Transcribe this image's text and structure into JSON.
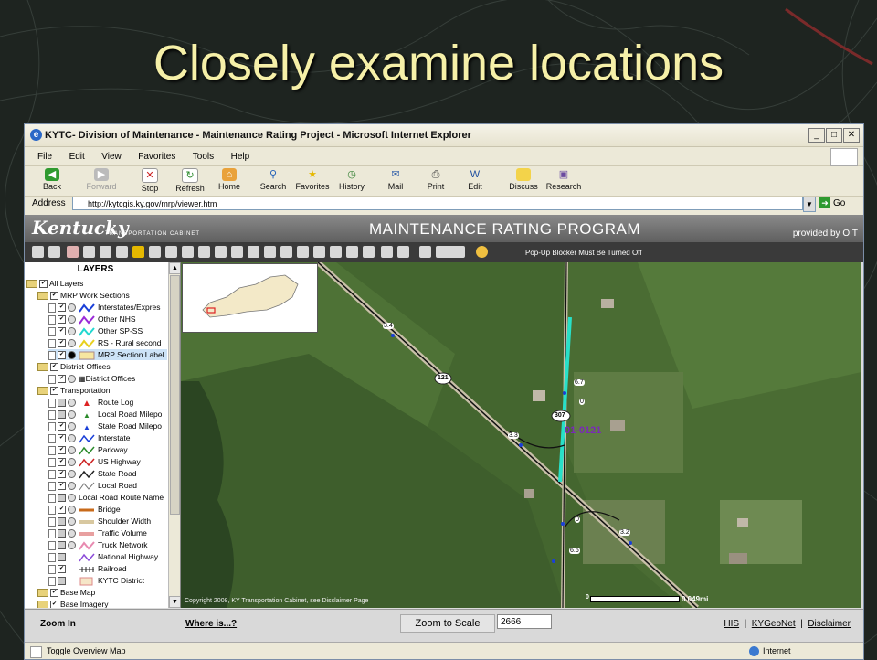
{
  "slide": {
    "title": "Closely examine locations"
  },
  "browser": {
    "window_title": "KYTC- Division of Maintenance - Maintenance Rating Project - Microsoft Internet Explorer",
    "menu": [
      "File",
      "Edit",
      "View",
      "Favorites",
      "Tools",
      "Help"
    ],
    "toolbar": [
      {
        "label": "Back",
        "icon": "back-arrow-icon",
        "enabled": true
      },
      {
        "label": "Forward",
        "icon": "forward-arrow-icon",
        "enabled": false
      },
      {
        "label": "Stop",
        "icon": "stop-icon",
        "enabled": true
      },
      {
        "label": "Refresh",
        "icon": "refresh-icon",
        "enabled": true
      },
      {
        "label": "Home",
        "icon": "home-icon",
        "enabled": true
      },
      {
        "label": "Search",
        "icon": "search-icon",
        "enabled": true
      },
      {
        "label": "Favorites",
        "icon": "star-icon",
        "enabled": true
      },
      {
        "label": "History",
        "icon": "history-icon",
        "enabled": true
      },
      {
        "label": "Mail",
        "icon": "mail-icon",
        "enabled": true
      },
      {
        "label": "Print",
        "icon": "print-icon",
        "enabled": true
      },
      {
        "label": "Edit",
        "icon": "edit-icon",
        "enabled": true
      },
      {
        "label": "Discuss",
        "icon": "discuss-icon",
        "enabled": true
      },
      {
        "label": "Research",
        "icon": "research-icon",
        "enabled": true
      }
    ],
    "address_label": "Address",
    "address": "http://kytcgis.ky.gov/mrp/viewer.htm",
    "go_label": "Go",
    "status_text": "Toggle Overview Map",
    "status_zone": "Internet"
  },
  "app": {
    "logo": "Kentucky",
    "logo_sub": "TRANSPORTATION CABINET",
    "program_title": "MAINTENANCE RATING PROGRAM",
    "provided_by": "provided by OIT",
    "popup_note": "Pop-Up Blocker Must Be Turned Off",
    "layers_header": "LAYERS",
    "layers": [
      {
        "label": "All Layers"
      },
      {
        "label": "MRP Work Sections"
      },
      {
        "label": "Interstates/Expres"
      },
      {
        "label": "Other NHS"
      },
      {
        "label": "Other SP-SS"
      },
      {
        "label": "RS - Rural second"
      },
      {
        "label": "MRP Section Label"
      },
      {
        "label": "District Offices"
      },
      {
        "label": "District Offices"
      },
      {
        "label": "Transportation"
      },
      {
        "label": "Route Log"
      },
      {
        "label": "Local Road Milepo"
      },
      {
        "label": "State Road Milepo"
      },
      {
        "label": "Interstate"
      },
      {
        "label": "Parkway"
      },
      {
        "label": "US Highway"
      },
      {
        "label": "State Road"
      },
      {
        "label": "Local Road"
      },
      {
        "label": "Local Road Route Name"
      },
      {
        "label": "Bridge"
      },
      {
        "label": "Shoulder Width"
      },
      {
        "label": "Traffic Volume"
      },
      {
        "label": "Truck Network"
      },
      {
        "label": "National Highway"
      },
      {
        "label": "Railroad"
      },
      {
        "label": "KYTC District"
      },
      {
        "label": "Base Map"
      },
      {
        "label": "Base Imagery"
      }
    ],
    "map_labels": {
      "route_121": "121",
      "route_307": "307",
      "section": "01-0121",
      "mp_34": "3.4",
      "mp_33": "3.3",
      "mp_67": "6.7",
      "mp_0a": "0",
      "mp_0b": "0",
      "mp_32": "3.2",
      "mp_66": "6.6"
    },
    "copyright": "Copyright 2008, KY Transportation Cabinet, see Disclaimer Page",
    "scale_zero": "0",
    "scale_label": "0.049mi",
    "zoom_in": "Zoom In",
    "where_is": "Where is...?",
    "zoom_to_scale": "Zoom to Scale",
    "scale_value": "2666",
    "links": [
      "HIS",
      "KYGeoNet",
      "Disclaimer"
    ]
  },
  "colors": {
    "slide_title": "#f6f0a8",
    "section_highlight": "#28e0c8",
    "route_line": "#111111"
  }
}
